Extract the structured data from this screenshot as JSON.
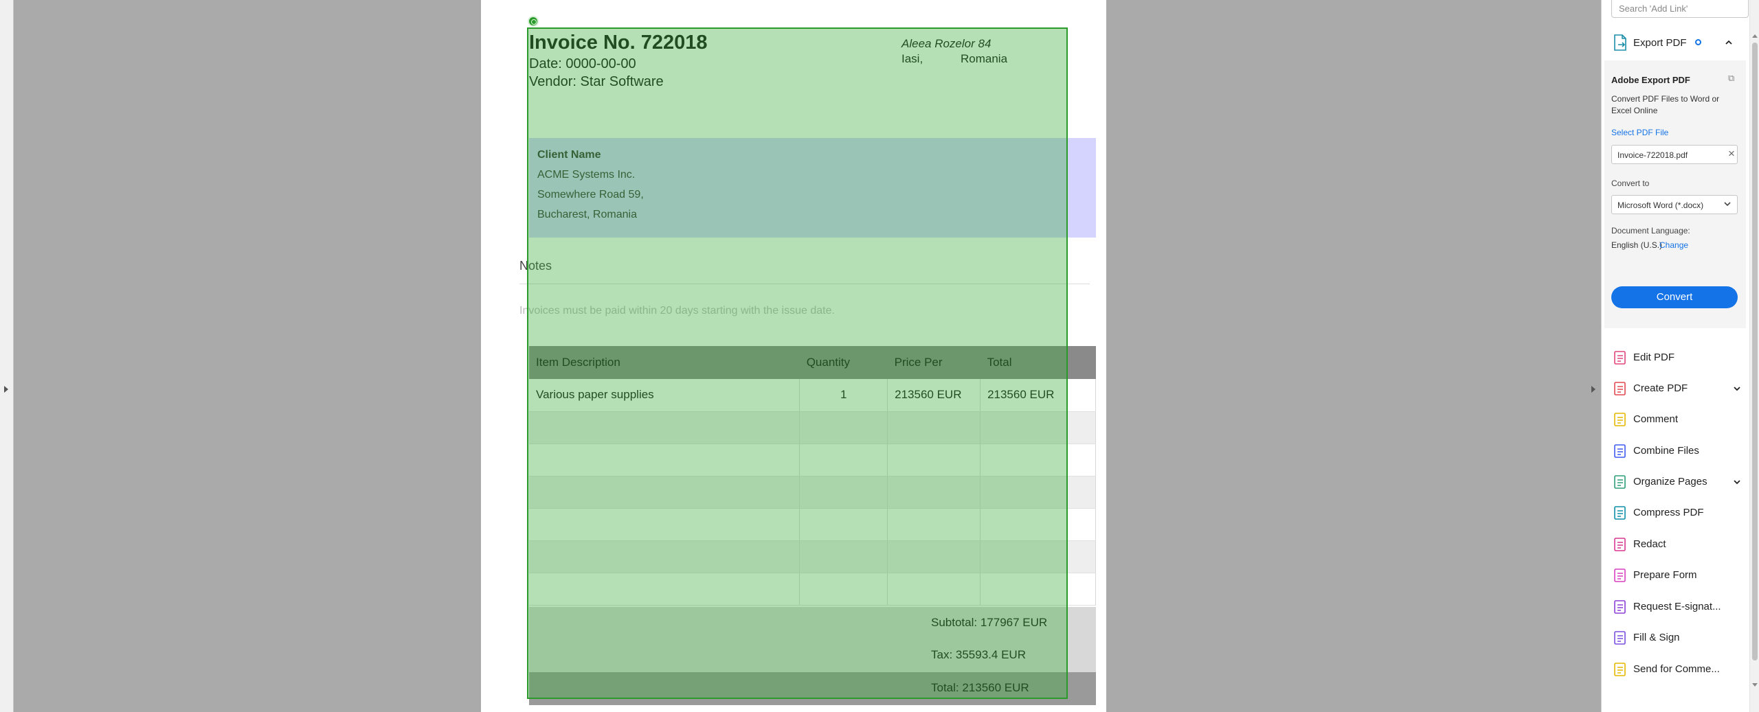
{
  "invoice": {
    "title": "Invoice No. 722018",
    "date": "Date: 0000-00-00",
    "vendor": "Vendor: Star Software",
    "address_line1": "Aleea Rozelor 84",
    "address_city": "Iasi,",
    "address_country": "Romania",
    "client_label": "Client Name",
    "client_lines": [
      "ACME Systems Inc.",
      "Somewhere Road 59,",
      "Bucharest, Romania"
    ],
    "notes_title": "Notes",
    "notes_text": "Invoices must be paid within 20 days starting with the issue date.",
    "table": {
      "headers": [
        "Item Description",
        "Quantity",
        "Price Per",
        "Total"
      ],
      "rows": [
        [
          "Various paper supplies",
          "1",
          "213560 EUR",
          "213560 EUR"
        ],
        [
          "",
          "",
          "",
          ""
        ],
        [
          "",
          "",
          "",
          ""
        ],
        [
          "",
          "",
          "",
          ""
        ],
        [
          "",
          "",
          "",
          ""
        ],
        [
          "",
          "",
          "",
          ""
        ],
        [
          "",
          "",
          "",
          ""
        ]
      ]
    },
    "subtotal": "Subtotal: 177967 EUR",
    "tax": "Tax: 35593.4 EUR",
    "total": "Total: 213560 EUR"
  },
  "panel": {
    "search_placeholder": "Search 'Add Link'",
    "export_header": "Export PDF",
    "card_title": "Adobe Export PDF",
    "card_desc": "Convert PDF Files to Word or Excel Online",
    "select_file": "Select PDF File",
    "file_name": "Invoice-722018.pdf",
    "convert_to_label": "Convert to",
    "format_value": "Microsoft Word (*.docx)",
    "doc_lang_label": "Document Language:",
    "doc_lang_value": "English (U.S.)",
    "change_link": "Change",
    "convert_button": "Convert",
    "tools": [
      {
        "label": "Edit PDF",
        "icon": "edit-pdf-icon",
        "color": "#e0457b"
      },
      {
        "label": "Create PDF",
        "icon": "create-pdf-icon",
        "color": "#e34850"
      },
      {
        "label": "Comment",
        "icon": "comment-icon",
        "color": "#e6b800"
      },
      {
        "label": "Combine Files",
        "icon": "combine-files-icon",
        "color": "#3d5af1"
      },
      {
        "label": "Organize Pages",
        "icon": "organize-pages-icon",
        "color": "#2d9d78"
      },
      {
        "label": "Compress PDF",
        "icon": "compress-pdf-icon",
        "color": "#0d8ea8"
      },
      {
        "label": "Redact",
        "icon": "redact-icon",
        "color": "#d83790"
      },
      {
        "label": "Prepare Form",
        "icon": "prepare-form-icon",
        "color": "#d93fc1"
      },
      {
        "label": "Request E-signat...",
        "icon": "request-esign-icon",
        "color": "#8b3fd9"
      },
      {
        "label": "Fill & Sign",
        "icon": "fill-sign-icon",
        "color": "#7a4fe0"
      },
      {
        "label": "Send for Comme...",
        "icon": "send-comment-icon",
        "color": "#e6b800"
      }
    ],
    "accent": "#1473e6"
  },
  "selection_color": "#2a9a2a"
}
